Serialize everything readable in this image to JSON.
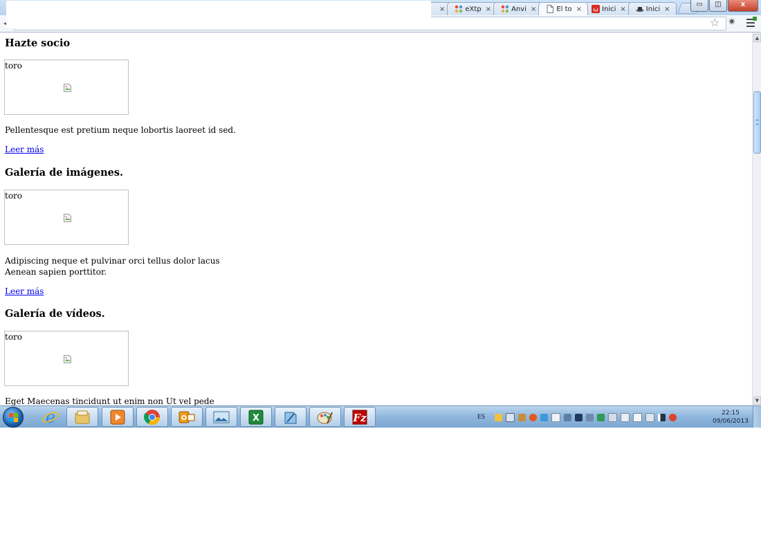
{
  "browser": {
    "tabs": [
      {
        "title": "",
        "favicon": "page-icon",
        "active": false
      },
      {
        "title": "eXtp",
        "favicon": "joomla-icon",
        "active": false
      },
      {
        "title": "Anvi",
        "favicon": "joomla-icon",
        "active": false
      },
      {
        "title": "El to",
        "favicon": "page-icon",
        "active": true
      },
      {
        "title": "Inici",
        "favicon": "wu-icon",
        "active": false
      },
      {
        "title": "Inici",
        "favicon": "hat-icon",
        "active": false
      }
    ],
    "tab_close": "×",
    "window_controls": {
      "minimize": "▭",
      "maximize": "◫",
      "close": "x"
    }
  },
  "page": {
    "articles": [
      {
        "heading": "Hazte socio",
        "image_alt": "toro",
        "description": [
          "Pellentesque est pretium neque lobortis laoreet id sed."
        ],
        "link": "Leer más"
      },
      {
        "heading": "Galería de imágenes.",
        "image_alt": "toro",
        "description": [
          "Adipiscing neque et pulvinar orci tellus dolor lacus",
          "Aenean sapien porttitor."
        ],
        "link": "Leer más"
      },
      {
        "heading": "Galería de vídeos.",
        "image_alt": "toro",
        "description": [
          "Eget Maecenas tincidunt ut enim non Ut vel pede"
        ],
        "link": ""
      }
    ]
  },
  "taskbar": {
    "pinned": [
      "internet-explorer-icon",
      "windows-explorer-icon",
      "media-player-icon",
      "chrome-icon",
      "outlook-icon",
      "photo-viewer-icon",
      "excel-icon",
      "notepad-icon",
      "paint-icon",
      "filezilla-icon"
    ],
    "language": "ES",
    "time": "22:15",
    "date": "09/06/2013"
  },
  "colors": {
    "link": "#0000ee",
    "taskbar": "#8fb6dc",
    "close_button": "#c4412a"
  }
}
